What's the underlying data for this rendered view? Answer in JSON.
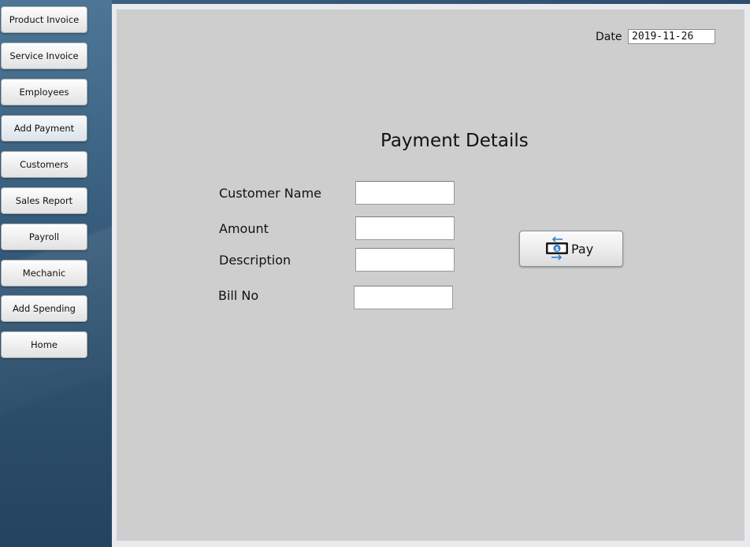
{
  "sidebar": {
    "items": [
      {
        "label": "Product Invoice"
      },
      {
        "label": "Service Invoice"
      },
      {
        "label": "Employees"
      },
      {
        "label": "Add Payment"
      },
      {
        "label": "Customers"
      },
      {
        "label": "Sales Report"
      },
      {
        "label": "Payroll"
      },
      {
        "label": "Mechanic"
      },
      {
        "label": "Add Spending"
      },
      {
        "label": "Home"
      }
    ],
    "active": "Add Payment"
  },
  "header": {
    "date_label": "Date",
    "date_value": "2019-11-26"
  },
  "form": {
    "title": "Payment Details",
    "customer_name_label": "Customer Name",
    "customer_name_value": "",
    "amount_label": "Amount",
    "amount_value": "",
    "description_label": "Description",
    "description_value": "",
    "bill_no_label": "Bill No",
    "bill_no_value": ""
  },
  "actions": {
    "pay_label": "Pay",
    "pay_icon": "money-exchange-icon"
  },
  "colors": {
    "sidebar_top": "#4d7696",
    "sidebar_bottom": "#24435e",
    "panel_bg": "#cecece",
    "icon_blue": "#2f7fd0"
  }
}
